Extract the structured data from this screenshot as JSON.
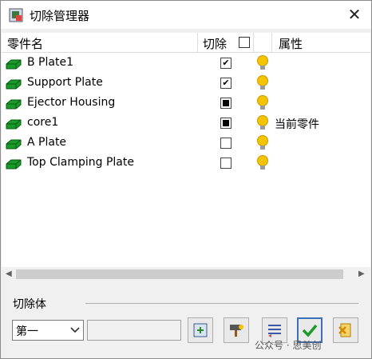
{
  "window": {
    "title": "切除管理器"
  },
  "table": {
    "columns": {
      "name": "零件名",
      "cut": "切除",
      "attr": "属性"
    },
    "rows": [
      {
        "name": "B Plate1",
        "cut": "checked",
        "attr": ""
      },
      {
        "name": "Support Plate",
        "cut": "checked",
        "attr": ""
      },
      {
        "name": "Ejector Housing",
        "cut": "mixed",
        "attr": ""
      },
      {
        "name": "core1",
        "cut": "mixed",
        "attr": "当前零件"
      },
      {
        "name": "A Plate",
        "cut": "unchecked",
        "attr": ""
      },
      {
        "name": "Top Clamping Plate",
        "cut": "unchecked",
        "attr": ""
      }
    ]
  },
  "section": {
    "label": "切除体"
  },
  "select": {
    "value": "第一"
  },
  "textbox": {
    "value": ""
  },
  "watermark": {
    "text": "公众号 · 思美创"
  },
  "colors": {
    "part_icon": "#1a9a2a",
    "bulb": "#f5c400",
    "ok": "#1e9a28",
    "cancel": "#e0a000"
  }
}
